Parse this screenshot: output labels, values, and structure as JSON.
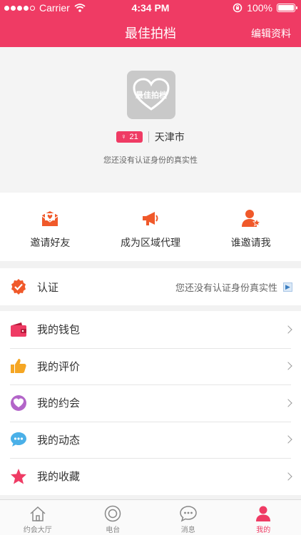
{
  "status_bar": {
    "carrier": "Carrier",
    "time": "4:34 PM",
    "battery": "100%"
  },
  "nav": {
    "title": "最佳拍档",
    "action": "编辑资料"
  },
  "profile": {
    "avatar_text": "最佳拍档",
    "age": "21",
    "city": "天津市",
    "verify_note": "您还没有认证身份的真实性"
  },
  "actions": [
    {
      "label": "邀请好友",
      "icon": "invite-mail-icon"
    },
    {
      "label": "成为区域代理",
      "icon": "megaphone-icon"
    },
    {
      "label": "谁邀请我",
      "icon": "user-star-icon"
    }
  ],
  "cert": {
    "label": "认证",
    "value": "您还没有认证身份真实性"
  },
  "menu": [
    {
      "label": "我的钱包",
      "icon": "wallet-icon"
    },
    {
      "label": "我的评价",
      "icon": "thumbs-up-icon"
    },
    {
      "label": "我的约会",
      "icon": "heart-icon"
    },
    {
      "label": "我的动态",
      "icon": "chat-bubble-icon"
    },
    {
      "label": "我的收藏",
      "icon": "star-icon"
    }
  ],
  "tabs": [
    {
      "label": "约会大厅",
      "icon": "home-icon"
    },
    {
      "label": "电台",
      "icon": "radio-icon"
    },
    {
      "label": "消息",
      "icon": "message-icon"
    },
    {
      "label": "我的",
      "icon": "person-icon",
      "active": true
    }
  ],
  "colors": {
    "accent": "#ef3b64",
    "orange": "#f0592a",
    "yellow": "#f5a623",
    "purple": "#b365c9",
    "blue": "#4ab0e8"
  }
}
